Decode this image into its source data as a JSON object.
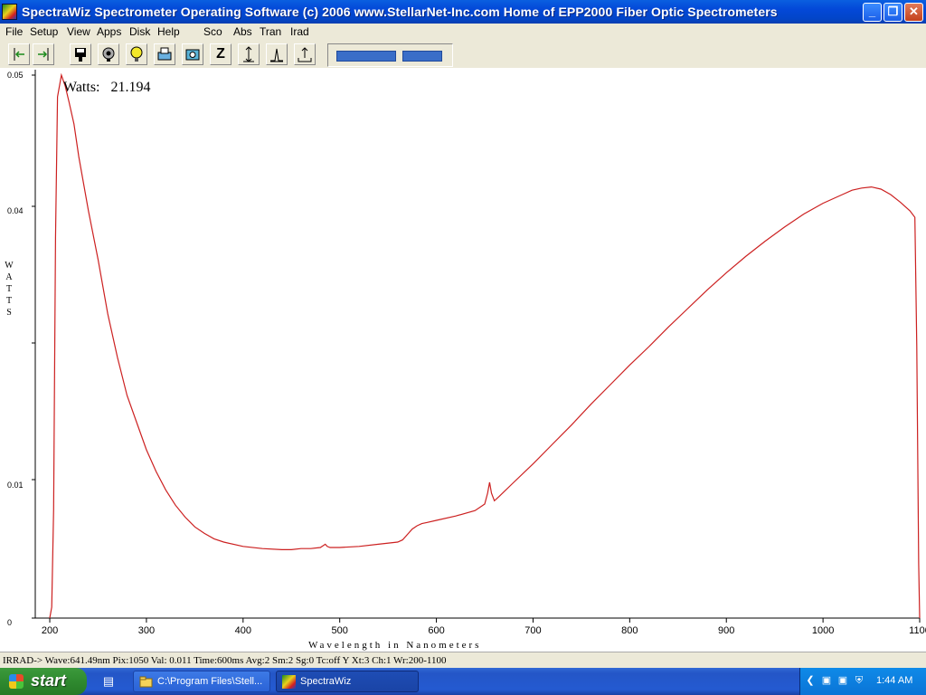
{
  "window": {
    "title": "SpectraWiz  Spectrometer Operating Software (c) 2006  www.StellarNet-Inc.com  Home of EPP2000 Fiber Optic Spectrometers",
    "icon": "spectrawiz-app-icon"
  },
  "menu": [
    "File",
    "Setup",
    "View",
    "Apps",
    "Disk",
    "Help",
    "Sco",
    "Abs",
    "Tran",
    "Irad"
  ],
  "toolbar": {
    "buttons": [
      "scroll-left-icon",
      "scroll-right-icon",
      "save-icon",
      "lamp-icon",
      "lightbulb-icon",
      "print-icon",
      "camera-icon",
      "zoom-z-icon",
      "autoscale-icon",
      "peak-icon",
      "export-icon"
    ],
    "z_label": "Z"
  },
  "plot": {
    "watts_label": "Watts:",
    "watts_value": "21.194",
    "y_axis_title": [
      "W",
      "A",
      "T",
      "T",
      "S"
    ],
    "x_axis_title": "Wavelength in Nanometers"
  },
  "chart_data": {
    "type": "line",
    "title": "",
    "xlabel": "Wavelength in Nanometers",
    "ylabel": "WATTS",
    "xlim": [
      185,
      1100
    ],
    "ylim": [
      0,
      0.05
    ],
    "x_ticks": [
      "200",
      "300",
      "400",
      "500",
      "600",
      "700",
      "800",
      "900",
      "1000",
      "1100"
    ],
    "y_ticks": [
      "0.05",
      "0.04",
      "0.01",
      "0"
    ],
    "y_tick_values": [
      0.05,
      0.04,
      0.01,
      0
    ],
    "grid": false,
    "line_color": "#cc2020",
    "series": [
      {
        "x": [
          200,
          202,
          204,
          206,
          208,
          212,
          216,
          220,
          225,
          230,
          240,
          250,
          260,
          270,
          280,
          290,
          300,
          310,
          320,
          330,
          340,
          350,
          360,
          370,
          380,
          400,
          420,
          440,
          450,
          460,
          470,
          480,
          485,
          487,
          490,
          500,
          520,
          540,
          560,
          565,
          570,
          575,
          580,
          585,
          590,
          600,
          620,
          640,
          650,
          653,
          655,
          657,
          660,
          665,
          680,
          700,
          720,
          740,
          760,
          780,
          800,
          820,
          840,
          860,
          880,
          900,
          920,
          940,
          960,
          980,
          1000,
          1020,
          1030,
          1040,
          1050,
          1060,
          1070,
          1080,
          1090,
          1095,
          1097,
          1099,
          1100
        ],
        "values": [
          0.0,
          0.001,
          0.01,
          0.035,
          0.048,
          0.05,
          0.049,
          0.0475,
          0.0455,
          0.0425,
          0.0375,
          0.033,
          0.028,
          0.024,
          0.0205,
          0.018,
          0.0155,
          0.0135,
          0.0118,
          0.0104,
          0.0093,
          0.0084,
          0.0078,
          0.0073,
          0.007,
          0.0066,
          0.0064,
          0.0063,
          0.0063,
          0.0064,
          0.0064,
          0.0065,
          0.0068,
          0.0066,
          0.0065,
          0.0065,
          0.0066,
          0.0068,
          0.007,
          0.0072,
          0.0077,
          0.0082,
          0.0085,
          0.0087,
          0.0088,
          0.009,
          0.0094,
          0.0099,
          0.0105,
          0.0115,
          0.0125,
          0.0115,
          0.0108,
          0.0112,
          0.0125,
          0.0142,
          0.016,
          0.0178,
          0.0197,
          0.0215,
          0.0233,
          0.025,
          0.0268,
          0.0285,
          0.0302,
          0.0318,
          0.0333,
          0.0347,
          0.036,
          0.0372,
          0.0382,
          0.039,
          0.0394,
          0.0396,
          0.0397,
          0.0395,
          0.039,
          0.0383,
          0.0375,
          0.0369,
          0.025,
          0.005,
          0.0
        ]
      }
    ]
  },
  "status": {
    "text": "IRRAD->  Wave:641.49nm  Pix:1050  Val:  0.011  Time:600ms  Avg:2  Sm:2  Sg:0   Tc:off Y  Xt:3   Ch:1   Wr:200-1100"
  },
  "taskbar": {
    "start_label": "start",
    "tasks": [
      {
        "label": "C:\\Program Files\\Stell...",
        "icon": "folder-icon"
      },
      {
        "label": "SpectraWiz",
        "icon": "spectrawiz-app-icon"
      }
    ],
    "clock": "1:44 AM"
  }
}
